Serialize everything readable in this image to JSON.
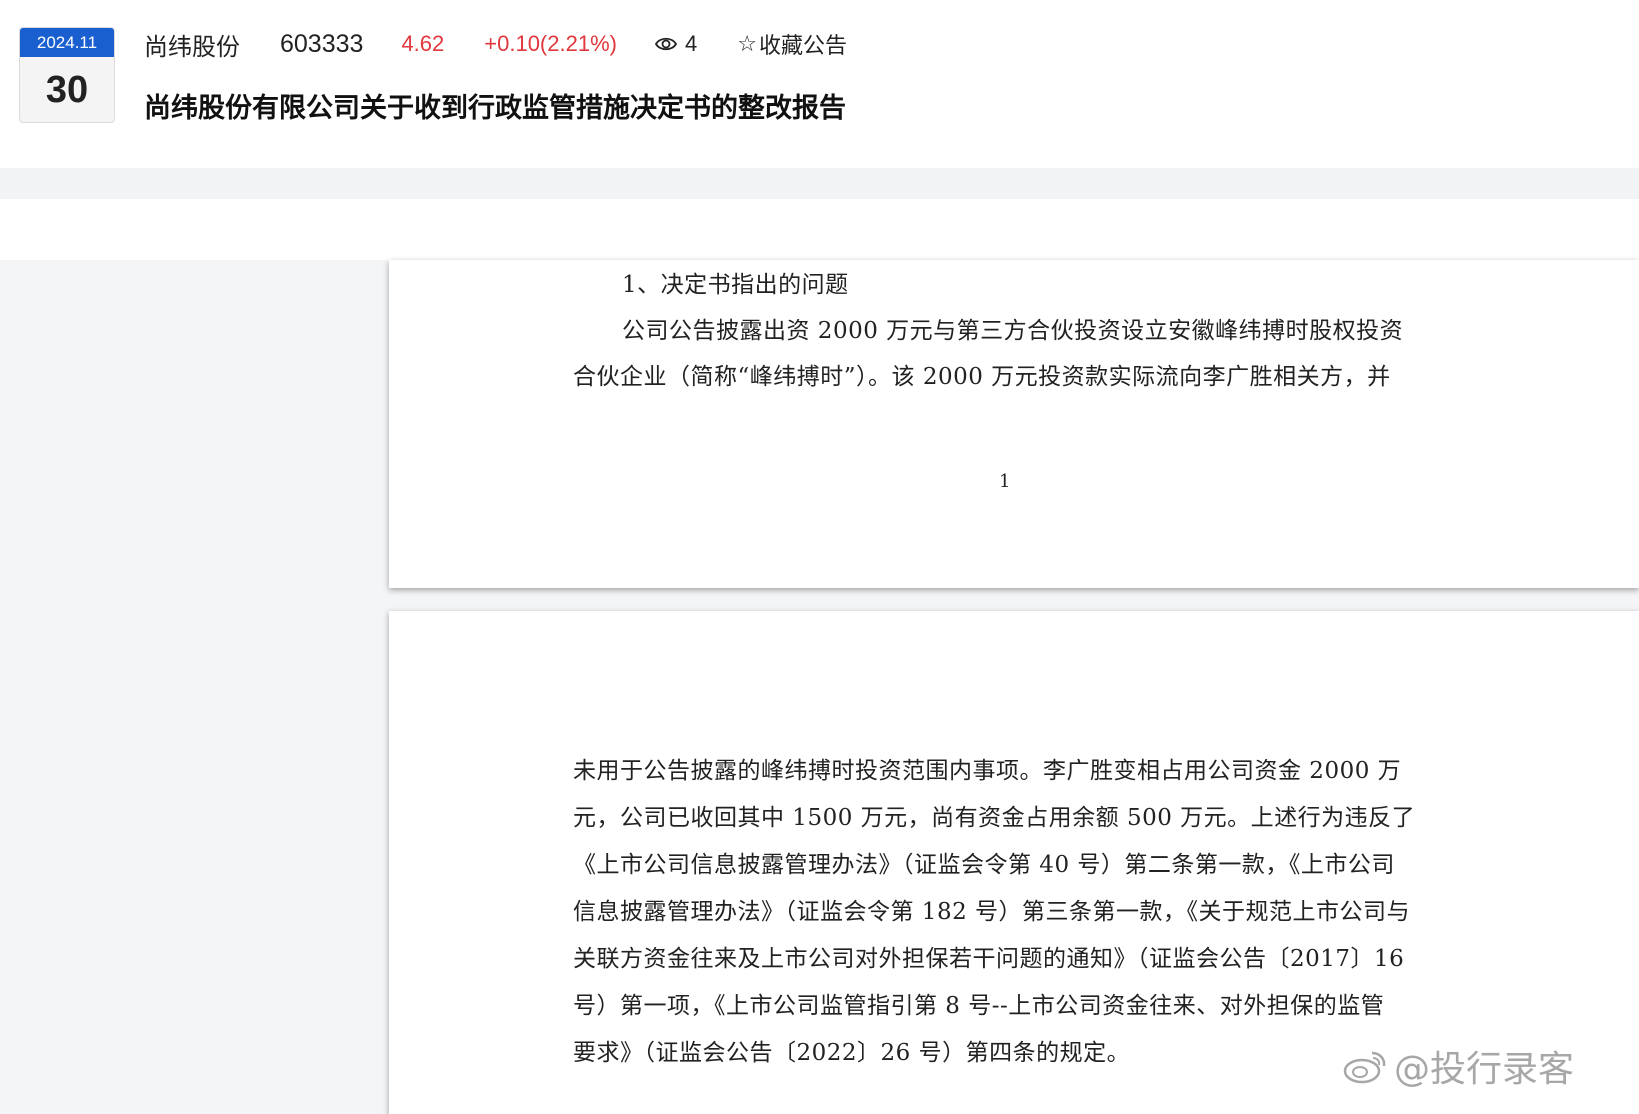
{
  "header": {
    "date_month": "2024.11",
    "date_day": "30",
    "stock_name": "尚纬股份",
    "stock_code": "603333",
    "price": "4.62",
    "change": "+0.10(2.21%)",
    "views": "4",
    "favorite_label": "收藏公告",
    "title": "尚纬股份有限公司关于收到行政监管措施决定书的整改报告"
  },
  "page1": {
    "lines": [
      "1、决定书指出的问题",
      "公司公告披露出资 2000 万元与第三方合伙投资设立安徽峰纬搏时股权投资",
      "合伙企业（简称“峰纬搏时”）。该 2000 万元投资款实际流向李广胜相关方，并"
    ],
    "page_number": "1"
  },
  "page2": {
    "lines": [
      "未用于公告披露的峰纬搏时投资范围内事项。李广胜变相占用公司资金 2000 万",
      "元，公司已收回其中 1500 万元，尚有资金占用余额 500 万元。上述行为违反了",
      "《上市公司信息披露管理办法》（证监会令第 40 号）第二条第一款，《上市公司",
      "信息披露管理办法》（证监会令第 182 号）第三条第一款，《关于规范上市公司与",
      "关联方资金往来及上市公司对外担保若干问题的通知》（证监会公告〔2017〕16",
      "号）第一项，《上市公司监管指引第 8 号--上市公司资金往来、对外担保的监管",
      "要求》（证监会公告〔2022〕26 号）第四条的规定。"
    ]
  },
  "watermark": "@投行录客",
  "colors": {
    "date_header": "#1a5fd0",
    "price_up": "#e0383e"
  }
}
